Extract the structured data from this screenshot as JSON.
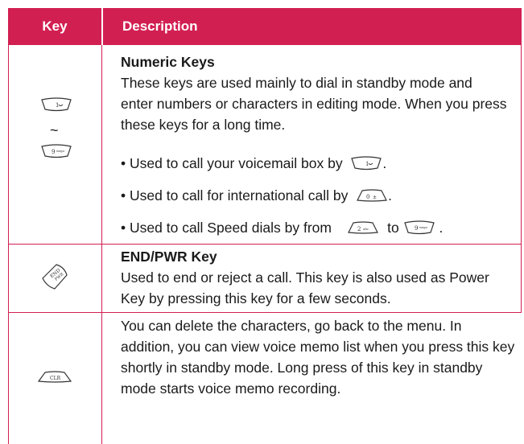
{
  "header": {
    "key": "Key",
    "description": "Description"
  },
  "rows": [
    {
      "title": "Numeric Keys",
      "text": "These keys are used mainly to dial in standby mode and enter numbers or characters in editing mode. When you press these keys for a long time.",
      "range_sep": "~",
      "bullets": [
        {
          "prefix": "•",
          "text": "Used to call your voicemail box by",
          "suffix": "."
        },
        {
          "prefix": "•",
          "text": "Used to call for international call by",
          "suffix": "."
        },
        {
          "prefix": "•",
          "text": "Used to call Speed dials by from",
          "mid": "to",
          "suffix": "."
        }
      ]
    },
    {
      "title": "END/PWR Key",
      "text": "Used to end or reject a call. This key is also used as Power Key by pressing this key for a few seconds."
    },
    {
      "text": "You can delete the characters, go back to the menu. In addition, you can view voice memo list when you press this key shortly in standby mode. Long press of this key in standby mode starts voice memo recording."
    }
  ],
  "icons": {
    "key1": "key-1-icon",
    "key9": "key-9-icon",
    "key0": "key-0-icon",
    "key2": "key-2-icon",
    "end": "end-pwr-key-icon",
    "clr": "clr-key-icon"
  },
  "colors": {
    "accent": "#d21f52"
  }
}
